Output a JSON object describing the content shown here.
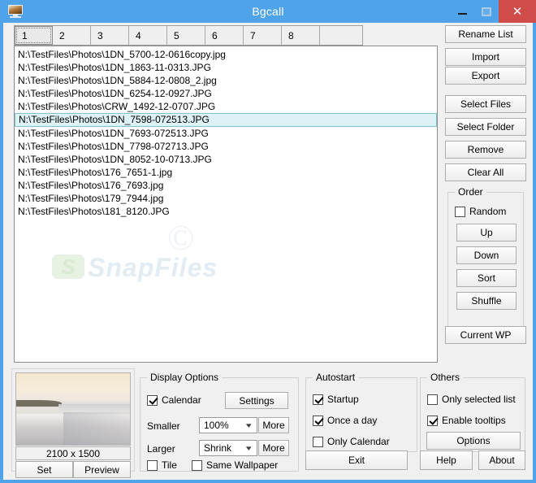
{
  "window": {
    "title": "Bgcall",
    "icon": "monitor-icon",
    "caption": {
      "minimize": "–",
      "maximize": "□",
      "close": "✕"
    },
    "accent_color": "#4fa3e8",
    "close_color": "#cf4c49"
  },
  "tabs": {
    "items": [
      "1",
      "2",
      "3",
      "4",
      "5",
      "6",
      "7",
      "8"
    ],
    "selected_index": 0
  },
  "file_list": {
    "selected_index": 5,
    "items": [
      "N:\\TestFiles\\Photos\\1DN_5700-12-0616copy.jpg",
      "N:\\TestFiles\\Photos\\1DN_1863-11-0313.JPG",
      "N:\\TestFiles\\Photos\\1DN_5884-12-0808_2.jpg",
      "N:\\TestFiles\\Photos\\1DN_6254-12-0927.JPG",
      "N:\\TestFiles\\Photos\\CRW_1492-12-0707.JPG",
      "N:\\TestFiles\\Photos\\1DN_7598-072513.JPG",
      "N:\\TestFiles\\Photos\\1DN_7693-072513.JPG",
      "N:\\TestFiles\\Photos\\1DN_7798-072713.JPG",
      "N:\\TestFiles\\Photos\\1DN_8052-10-0713.JPG",
      "N:\\TestFiles\\Photos\\176_7651-1.jpg",
      "N:\\TestFiles\\Photos\\176_7693.jpg",
      "N:\\TestFiles\\Photos\\179_7944.jpg",
      "N:\\TestFiles\\Photos\\181_8120.JPG"
    ]
  },
  "watermark": {
    "copyright": "©",
    "logo": "S",
    "text": "SnapFiles"
  },
  "side_buttons": {
    "rename_list": "Rename List",
    "import": "Import",
    "export": "Export",
    "select_files": "Select Files",
    "select_folder": "Select Folder",
    "remove": "Remove",
    "clear_all": "Clear All",
    "current_wp": "Current WP"
  },
  "order_group": {
    "legend": "Order",
    "random": "Random",
    "random_checked": false,
    "up": "Up",
    "down": "Down",
    "sort": "Sort",
    "shuffle": "Shuffle"
  },
  "preview": {
    "dimensions": "2100 x 1500",
    "set": "Set",
    "preview": "Preview"
  },
  "display_options": {
    "legend": "Display Options",
    "calendar": "Calendar",
    "calendar_checked": true,
    "settings": "Settings",
    "smaller_label": "Smaller",
    "smaller_value": "100%",
    "smaller_more": "More",
    "larger_label": "Larger",
    "larger_value": "Shrink",
    "larger_more": "More",
    "tile": "Tile",
    "tile_checked": false,
    "same_wallpaper": "Same Wallpaper",
    "same_wallpaper_checked": false
  },
  "autostart": {
    "legend": "Autostart",
    "startup": "Startup",
    "startup_checked": true,
    "once_a_day": "Once a day",
    "once_a_day_checked": true,
    "only_calendar": "Only Calendar",
    "only_calendar_checked": false
  },
  "others": {
    "legend": "Others",
    "only_selected_list": "Only selected list",
    "only_selected_list_checked": false,
    "enable_tooltips": "Enable tooltips",
    "enable_tooltips_checked": true,
    "options": "Options"
  },
  "footer": {
    "exit": "Exit",
    "help": "Help",
    "about": "About"
  }
}
